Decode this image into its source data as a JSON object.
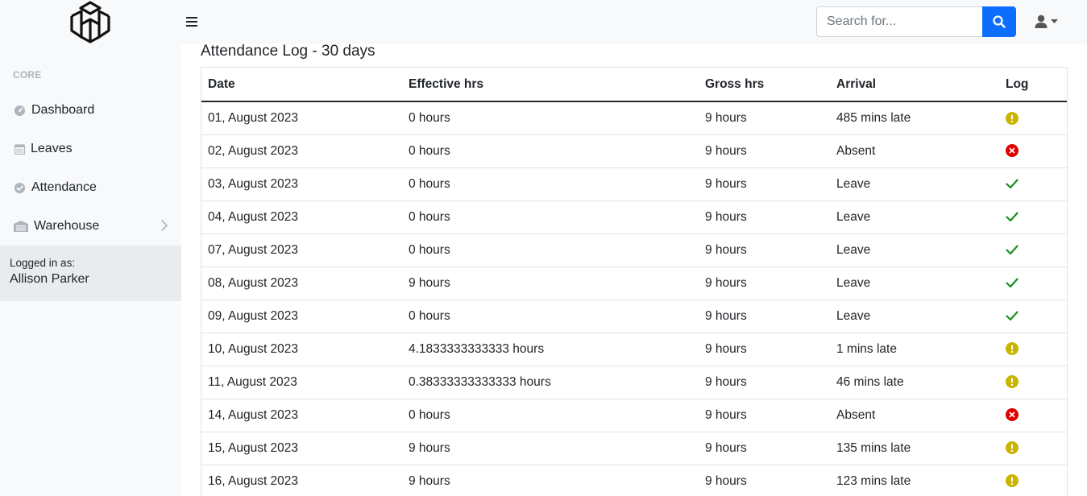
{
  "header": {
    "search": {
      "placeholder": "Search for...",
      "value": ""
    }
  },
  "sidebar": {
    "heading": "CORE",
    "items": [
      {
        "label": "Dashboard",
        "icon": "dashboard-gauge-icon"
      },
      {
        "label": "Leaves",
        "icon": "calendar-icon"
      },
      {
        "label": "Attendance",
        "icon": "check-circle-icon"
      },
      {
        "label": "Warehouse",
        "icon": "warehouse-icon"
      }
    ],
    "footer": {
      "label": "Logged in as:",
      "user": "Allison Parker"
    }
  },
  "main": {
    "title": "Attendance Log - 30 days",
    "columns": [
      "Date",
      "Effective hrs",
      "Gross hrs",
      "Arrival",
      "Log"
    ],
    "rows": [
      {
        "date": "01, August 2023",
        "effective": "0 hours",
        "gross": "9 hours",
        "arrival": "485 mins late",
        "log": "late"
      },
      {
        "date": "02, August 2023",
        "effective": "0 hours",
        "gross": "9 hours",
        "arrival": "Absent",
        "log": "absent"
      },
      {
        "date": "03, August 2023",
        "effective": "0 hours",
        "gross": "9 hours",
        "arrival": "Leave",
        "log": "ok"
      },
      {
        "date": "04, August 2023",
        "effective": "0 hours",
        "gross": "9 hours",
        "arrival": "Leave",
        "log": "ok"
      },
      {
        "date": "07, August 2023",
        "effective": "0 hours",
        "gross": "9 hours",
        "arrival": "Leave",
        "log": "ok"
      },
      {
        "date": "08, August 2023",
        "effective": "9 hours",
        "gross": "9 hours",
        "arrival": "Leave",
        "log": "ok"
      },
      {
        "date": "09, August 2023",
        "effective": "0 hours",
        "gross": "9 hours",
        "arrival": "Leave",
        "log": "ok"
      },
      {
        "date": "10, August 2023",
        "effective": "4.1833333333333 hours",
        "gross": "9 hours",
        "arrival": "1 mins late",
        "log": "late"
      },
      {
        "date": "11, August 2023",
        "effective": "0.38333333333333 hours",
        "gross": "9 hours",
        "arrival": "46 mins late",
        "log": "late"
      },
      {
        "date": "14, August 2023",
        "effective": "0 hours",
        "gross": "9 hours",
        "arrival": "Absent",
        "log": "absent"
      },
      {
        "date": "15, August 2023",
        "effective": "9 hours",
        "gross": "9 hours",
        "arrival": "135 mins late",
        "log": "late"
      },
      {
        "date": "16, August 2023",
        "effective": "9 hours",
        "gross": "9 hours",
        "arrival": "123 mins late",
        "log": "late"
      }
    ]
  },
  "colors": {
    "primary": "#0d6efd",
    "late": "#c9b400",
    "absent": "#e00000",
    "ok": "#198f1c"
  }
}
